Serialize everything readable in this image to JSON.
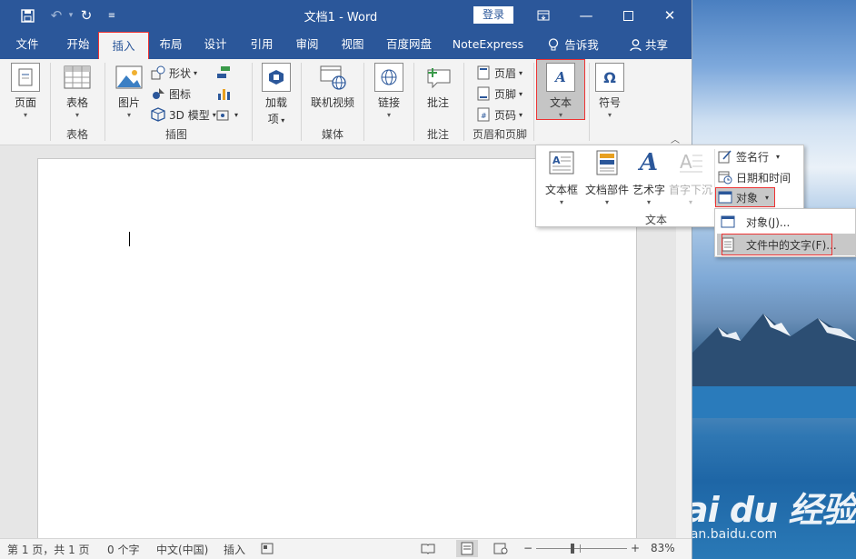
{
  "window": {
    "title": "文档1  -  Word",
    "login": "登录"
  },
  "quick_access": [
    "save-icon",
    "undo-icon",
    "redo-icon",
    "customize-icon"
  ],
  "tabs": [
    "文件",
    "开始",
    "插入",
    "布局",
    "设计",
    "引用",
    "审阅",
    "视图",
    "百度网盘",
    "NoteExpress",
    "告诉我",
    "共享"
  ],
  "active_tab": "插入",
  "ribbon": {
    "pages": "页面",
    "table": "表格",
    "table_group": "表格",
    "picture": "图片",
    "shapes": "形状",
    "icons": "图标",
    "model3d": "3D 模型",
    "illustrations_group": "插图",
    "addins_l1": "加载",
    "addins_l2": "项",
    "online_video": "联机视频",
    "media_group": "媒体",
    "links": "链接",
    "comment": "批注",
    "comments_group": "批注",
    "header": "页眉",
    "footer": "页脚",
    "page_number": "页码",
    "header_footer_group": "页眉和页脚",
    "text": "文本",
    "symbol": "符号"
  },
  "text_panel": {
    "textbox": "文本框",
    "quickparts": "文档部件",
    "wordart": "艺术字",
    "dropcap": "首字下沉",
    "signature": "签名行",
    "datetime": "日期和时间",
    "object": "对象",
    "group_label": "文本"
  },
  "object_menu": {
    "object": "对象(J)...",
    "text_from_file": "文件中的文字(F)..."
  },
  "status": {
    "page": "第 1 页，共 1 页",
    "words": "0 个字",
    "language": "中文(中国)",
    "mode": "插入",
    "zoom": "83%"
  },
  "watermark": {
    "brand": "Bai du 经验",
    "url": "jingyan.baidu.com"
  }
}
